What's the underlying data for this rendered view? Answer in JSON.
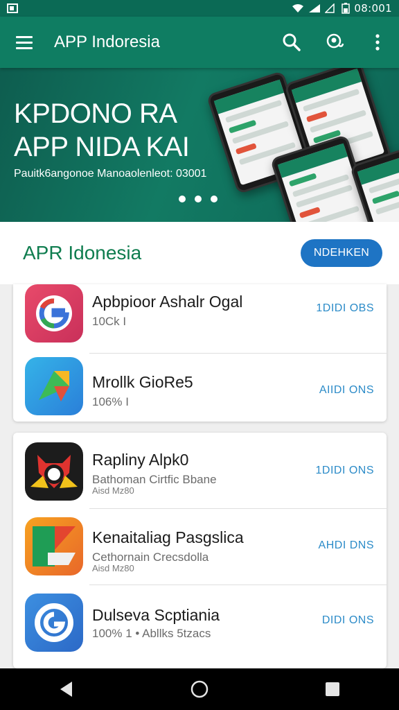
{
  "status_bar": {
    "time": "08:001"
  },
  "app_bar": {
    "title": "APP Indoresia"
  },
  "banner": {
    "title_line1": "KPDONO RA",
    "title_line2": "APP  NIDA KAI",
    "subtitle": "Pauitk6angonoe Manoaolenleot: 03001"
  },
  "section": {
    "title": "APR Idonesia",
    "button_label": "NDEHKEN"
  },
  "apps": [
    {
      "name": "Apbpioor Ashalr Ogal",
      "meta": "10Ck I",
      "meta2": "",
      "install_label": "1DIDI OBS",
      "icon": "g-logo-icon"
    },
    {
      "name": "Mrollk GioRe5",
      "meta": "106% I",
      "meta2": "",
      "install_label": "AIIDI ONS",
      "icon": "maps-icon"
    },
    {
      "name": "Rapliny Alpk0",
      "meta": "Bathoman Cirtfic Bbane",
      "meta2": "Aisd Mz80",
      "install_label": "1DIDI ONS",
      "icon": "fox-icon"
    },
    {
      "name": "Kenaitaliag Pasgslica",
      "meta": "Cethornain Crecsdolla",
      "meta2": "Aisd Mz80",
      "install_label": "AHDI DNS",
      "icon": "shapes-icon"
    },
    {
      "name": "Dulseva Scptiania",
      "meta": "100% 1 •  Abllks 5tzacs",
      "meta2": "",
      "install_label": "DIDI ONS",
      "icon": "spiral-icon"
    }
  ],
  "colors": {
    "primary": "#0f7d62",
    "accent_blue": "#1e74c4",
    "section_title": "#0f7d4f",
    "install_text": "#2b8bc8"
  }
}
